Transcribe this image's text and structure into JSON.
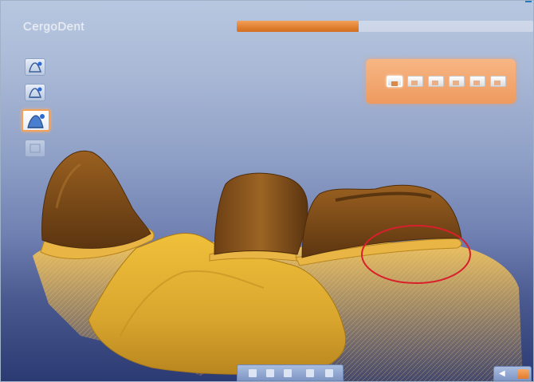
{
  "app": {
    "title": "CergoDent",
    "progress_fraction": 0.41
  },
  "colors": {
    "accent_orange": "#e8833a",
    "background_top": "#b7c7e0",
    "background_bottom": "#2b3a72",
    "crown_brown": "#7a4a18",
    "model_yellow": "#d9a62e",
    "highlight_circle": "#d8202c"
  },
  "side_tools": [
    {
      "icon": "preparation-view-icon",
      "state": "normal"
    },
    {
      "icon": "model-view-icon",
      "state": "normal"
    },
    {
      "icon": "crown-view-icon",
      "state": "active"
    },
    {
      "icon": "reset-view-icon",
      "state": "disabled"
    }
  ],
  "view_panel": {
    "buttons": [
      {
        "icon": "view-front-icon",
        "active": true
      },
      {
        "icon": "view-back-icon",
        "active": false
      },
      {
        "icon": "view-top-icon",
        "active": false
      },
      {
        "icon": "view-bottom-icon",
        "active": false
      },
      {
        "icon": "view-left-icon",
        "active": false
      },
      {
        "icon": "view-right-icon",
        "active": false
      }
    ]
  },
  "bottom_toolbar": {
    "buttons": [
      {
        "icon": "zoom-icon"
      },
      {
        "icon": "rotate-icon"
      },
      {
        "icon": "pan-icon"
      },
      {
        "icon": "cut-icon"
      },
      {
        "icon": "settings-icon"
      }
    ]
  },
  "navigation": {
    "back_icon": "back-arrow-icon",
    "next_icon": "next-step-icon"
  }
}
